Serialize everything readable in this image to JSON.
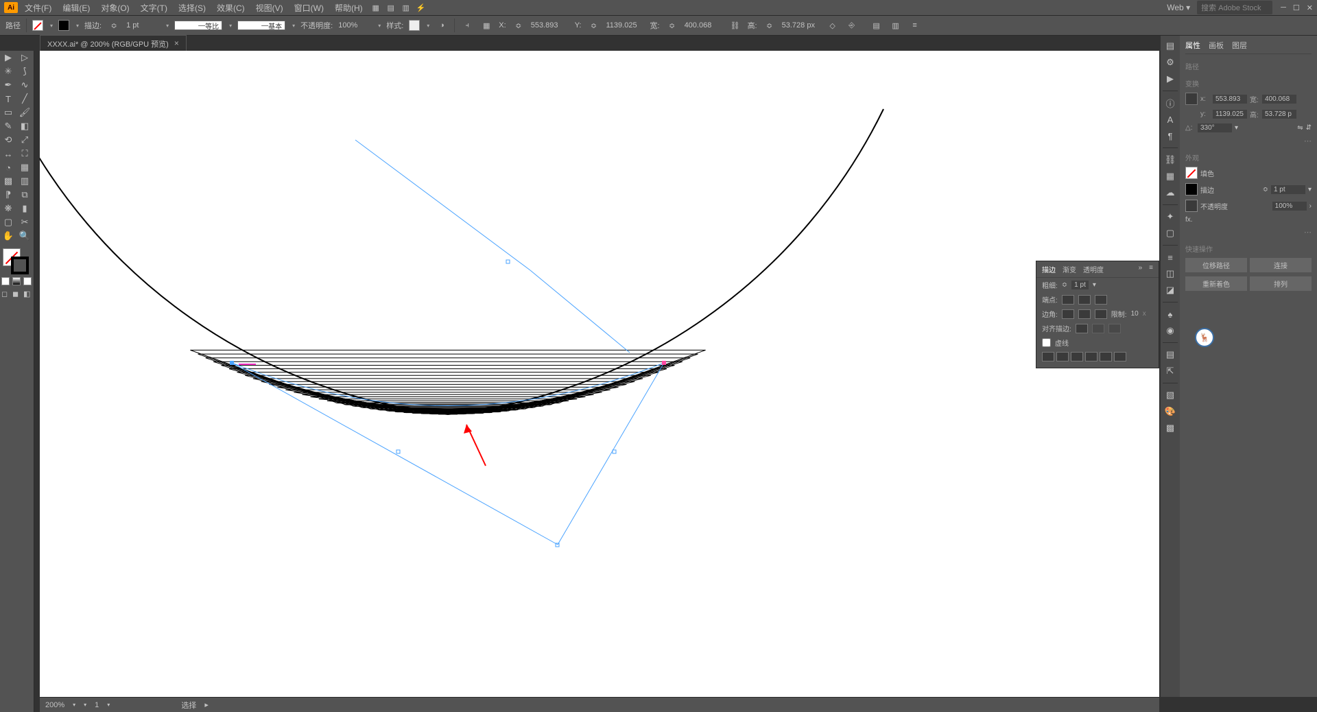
{
  "app": {
    "logo": "Ai"
  },
  "menu": {
    "file": "文件(F)",
    "edit": "编辑(E)",
    "object": "对象(O)",
    "type": "文字(T)",
    "select": "选择(S)",
    "effect": "效果(C)",
    "view": "视图(V)",
    "window": "窗口(W)",
    "help": "帮助(H)"
  },
  "workspace": {
    "label": "Web",
    "search_placeholder": "搜索 Adobe Stock"
  },
  "control": {
    "path_label": "路径",
    "stroke_label": "描边:",
    "stroke_weight": "1 pt",
    "uniform": "等比",
    "basic": "基本",
    "opacity_label": "不透明度:",
    "opacity_value": "100%",
    "style_label": "样式:",
    "x_label": "X:",
    "x_value": "553.893",
    "y_label": "Y:",
    "y_value": "1139.025",
    "w_label": "宽:",
    "w_value": "400.068",
    "h_label": "高:",
    "h_value": "53.728 px"
  },
  "tab": {
    "title": "XXXX.ai* @ 200% (RGB/GPU 预览)"
  },
  "props": {
    "tab_properties": "属性",
    "tab_artboards": "画板",
    "tab_layers": "图层",
    "section_path": "路径",
    "section_transform": "变换",
    "x_label": "x:",
    "x_value": "553.893",
    "y_label": "y:",
    "y_value": "1139.025",
    "w_label": "宽:",
    "w_value": "400.068",
    "h_label": "高:",
    "h_value": "53.728 p",
    "angle_label": "△:",
    "angle_value": "330°",
    "section_appearance": "外观",
    "fill_label": "填色",
    "stroke_label": "描边",
    "stroke_value": "1 pt",
    "opacity_label": "不透明度",
    "opacity_value": "100%",
    "fx_label": "fx.",
    "section_quick": "快速操作",
    "btn_offset": "位移路径",
    "btn_join": "连接",
    "btn_recolor": "重新着色",
    "btn_arrange": "排列"
  },
  "stroke": {
    "tab_stroke": "描边",
    "tab_gradient": "渐变",
    "tab_transparency": "透明度",
    "weight_label": "粗细:",
    "weight_value": "1 pt",
    "cap_label": "端点:",
    "corner_label": "边角:",
    "limit_label": "限制:",
    "limit_value": "10",
    "align_label": "对齐描边:",
    "dashed_label": "虚线"
  },
  "status": {
    "zoom": "200%",
    "artboard": "1",
    "tool": "选择"
  }
}
